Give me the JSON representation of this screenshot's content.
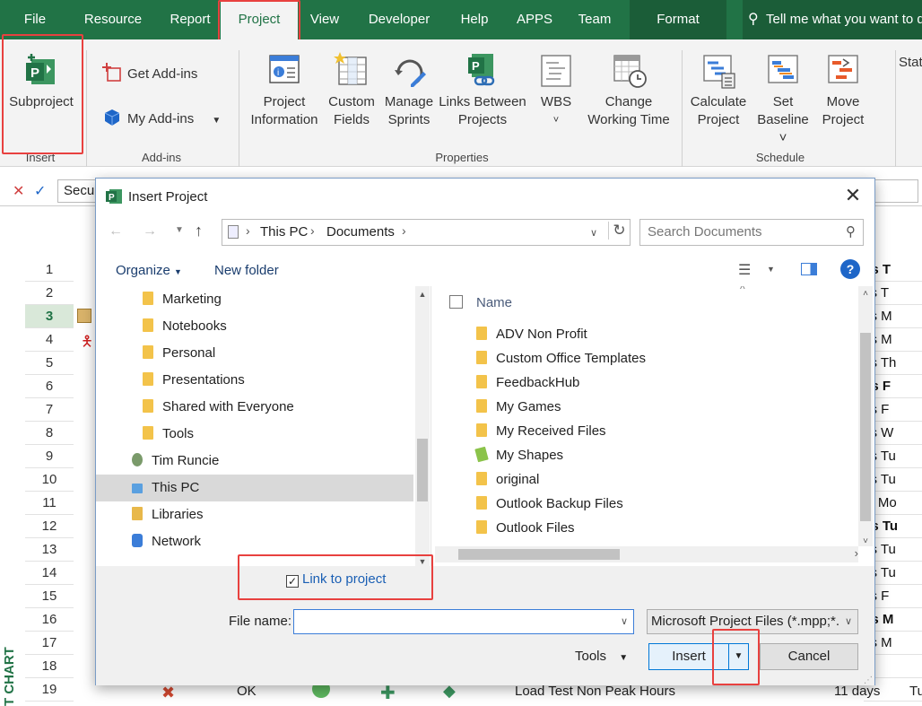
{
  "tabs": [
    "File",
    "Resource",
    "Report",
    "Project",
    "View",
    "Developer",
    "Help",
    "APPS",
    "Team",
    "Format"
  ],
  "tellme": "Tell me what you want to do",
  "ribbon": {
    "insert": {
      "subproject": "Subproject",
      "group": "Insert"
    },
    "addins": {
      "get": "Get Add-ins",
      "my": "My Add-ins",
      "group": "Add-ins"
    },
    "properties": {
      "items": [
        {
          "l1": "Project",
          "l2": "Information"
        },
        {
          "l1": "Custom",
          "l2": "Fields"
        },
        {
          "l1": "Manage",
          "l2": "Sprints"
        },
        {
          "l1": "Links Between",
          "l2": "Projects"
        },
        {
          "l1": "WBS",
          "l2": "˅"
        },
        {
          "l1": "Change",
          "l2": "Working Time"
        }
      ],
      "group": "Properties"
    },
    "schedule": {
      "items": [
        {
          "l1": "Calculate",
          "l2": "Project"
        },
        {
          "l1": "Set",
          "l2": "Baseline ˅"
        },
        {
          "l1": "Move",
          "l2": "Project"
        }
      ],
      "group": "Schedule"
    },
    "status_partial": "Stat"
  },
  "formula": {
    "cancel": "✕",
    "enter": "✓",
    "value": "Secu"
  },
  "grid": {
    "rows": [
      "1",
      "2",
      "3",
      "4",
      "5",
      "6",
      "7",
      "8",
      "9",
      "10",
      "11",
      "12",
      "13",
      "14",
      "15",
      "16",
      "17",
      "18",
      "19"
    ],
    "right_texts": [
      "ys  T",
      "ys  T",
      "ys  M",
      "ys  M",
      "ys  Th",
      "ys  F",
      "ys  F",
      "ys  W",
      "ys  Tu",
      "ys  Tu",
      "ts  Mo",
      "ys  Tu",
      "ys  Tu",
      "ys  Tu",
      "ys  F",
      "ys  M",
      "ys  M",
      "",
      ""
    ],
    "row19": {
      "status": "OK",
      "task": "Load Test Non Peak Hours",
      "duration": "11 days",
      "start": "Tu"
    },
    "side_label": "T CHART"
  },
  "dialog": {
    "title": "Insert Project",
    "path": [
      "This PC",
      "Documents"
    ],
    "search_placeholder": "Search Documents",
    "organize": "Organize",
    "new_folder": "New folder",
    "nav_items": [
      {
        "label": "Marketing",
        "type": "folder"
      },
      {
        "label": "Notebooks",
        "type": "folder"
      },
      {
        "label": "Personal",
        "type": "folder"
      },
      {
        "label": "Presentations",
        "type": "folder"
      },
      {
        "label": "Shared with Everyone",
        "type": "folder"
      },
      {
        "label": "Tools",
        "type": "folder"
      },
      {
        "label": "Tim Runcie",
        "type": "user"
      },
      {
        "label": "This PC",
        "type": "pc"
      },
      {
        "label": "Libraries",
        "type": "libraries"
      },
      {
        "label": "Network",
        "type": "network"
      }
    ],
    "column_name": "Name",
    "files": [
      "ADV Non Profit",
      "Custom Office Templates",
      "FeedbackHub",
      "My Games",
      "My Received Files",
      "My Shapes",
      "original",
      "Outlook Backup Files",
      "Outlook Files"
    ],
    "link_to_project": "Link to project",
    "file_name_label": "File name:",
    "file_name_value": "",
    "file_type": "Microsoft Project Files (*.mpp;*.",
    "tools": "Tools",
    "insert": "Insert",
    "cancel": "Cancel"
  },
  "colors": {
    "accent": "#217346",
    "highlight": "#e8413f",
    "link": "#1a5fb4"
  }
}
